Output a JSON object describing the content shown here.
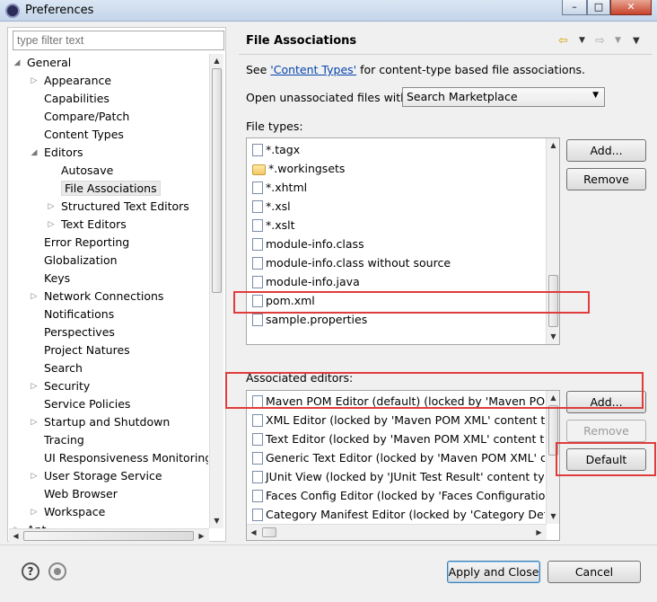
{
  "window": {
    "title": "Preferences",
    "min_label": "–",
    "max_label": "□",
    "close_label": "✕"
  },
  "filter": {
    "placeholder": "type filter text"
  },
  "tree": [
    {
      "label": "General",
      "indent": 0,
      "state": "open"
    },
    {
      "label": "Appearance",
      "indent": 1,
      "state": "closed"
    },
    {
      "label": "Capabilities",
      "indent": 1,
      "state": "leaf"
    },
    {
      "label": "Compare/Patch",
      "indent": 1,
      "state": "leaf"
    },
    {
      "label": "Content Types",
      "indent": 1,
      "state": "leaf"
    },
    {
      "label": "Editors",
      "indent": 1,
      "state": "open"
    },
    {
      "label": "Autosave",
      "indent": 2,
      "state": "leaf"
    },
    {
      "label": "File Associations",
      "indent": 2,
      "state": "leaf",
      "selected": true
    },
    {
      "label": "Structured Text Editors",
      "indent": 2,
      "state": "closed"
    },
    {
      "label": "Text Editors",
      "indent": 2,
      "state": "closed"
    },
    {
      "label": "Error Reporting",
      "indent": 1,
      "state": "leaf"
    },
    {
      "label": "Globalization",
      "indent": 1,
      "state": "leaf"
    },
    {
      "label": "Keys",
      "indent": 1,
      "state": "leaf"
    },
    {
      "label": "Network Connections",
      "indent": 1,
      "state": "closed"
    },
    {
      "label": "Notifications",
      "indent": 1,
      "state": "leaf"
    },
    {
      "label": "Perspectives",
      "indent": 1,
      "state": "leaf"
    },
    {
      "label": "Project Natures",
      "indent": 1,
      "state": "leaf"
    },
    {
      "label": "Search",
      "indent": 1,
      "state": "leaf"
    },
    {
      "label": "Security",
      "indent": 1,
      "state": "closed"
    },
    {
      "label": "Service Policies",
      "indent": 1,
      "state": "leaf"
    },
    {
      "label": "Startup and Shutdown",
      "indent": 1,
      "state": "closed"
    },
    {
      "label": "Tracing",
      "indent": 1,
      "state": "leaf"
    },
    {
      "label": "UI Responsiveness Monitoring",
      "indent": 1,
      "state": "leaf"
    },
    {
      "label": "User Storage Service",
      "indent": 1,
      "state": "closed"
    },
    {
      "label": "Web Browser",
      "indent": 1,
      "state": "leaf"
    },
    {
      "label": "Workspace",
      "indent": 1,
      "state": "closed"
    },
    {
      "label": "Ant",
      "indent": 0,
      "state": "closed"
    }
  ],
  "page": {
    "title": "File Associations",
    "see_prefix": "See ",
    "see_link": "'Content Types'",
    "see_suffix": " for content-type based file associations.",
    "open_label": "Open unassociated files with:",
    "open_value": "Search Marketplace",
    "file_types_label": "File types:",
    "assoc_label": "Associated editors:"
  },
  "file_types": [
    {
      "name": "*.tagx",
      "icon": "file-icon"
    },
    {
      "name": "*.workingsets",
      "icon": "folder-icon"
    },
    {
      "name": "*.xhtml",
      "icon": "web-file-icon"
    },
    {
      "name": "*.xsl",
      "icon": "xsl-file-icon"
    },
    {
      "name": "*.xslt",
      "icon": "xsl-file-icon"
    },
    {
      "name": "module-info.class",
      "icon": "class-file-icon"
    },
    {
      "name": "module-info.class without source",
      "icon": "class-file-icon"
    },
    {
      "name": "module-info.java",
      "icon": "java-file-icon"
    },
    {
      "name": "pom.xml",
      "icon": "maven-file-icon"
    },
    {
      "name": "sample.properties",
      "icon": "properties-file-icon"
    }
  ],
  "editors": [
    {
      "name": "Maven POM Editor (default) (locked by 'Maven POM",
      "icon": "maven-editor-icon"
    },
    {
      "name": "XML Editor (locked by 'Maven POM XML' content typ",
      "icon": "xml-editor-icon"
    },
    {
      "name": "Text Editor (locked by 'Maven POM XML' content typ",
      "icon": "text-editor-icon"
    },
    {
      "name": "Generic Text Editor (locked by 'Maven POM XML' co",
      "icon": "generic-editor-icon"
    },
    {
      "name": "JUnit View (locked by 'JUnit Test Result' content type)",
      "icon": "junit-icon"
    },
    {
      "name": "Faces Config Editor (locked by 'Faces Configuration F",
      "icon": "faces-icon"
    },
    {
      "name": "Category Manifest Editor (locked by 'Category Defini",
      "icon": "category-icon"
    }
  ],
  "buttons": {
    "add_types": "Add...",
    "remove_types": "Remove",
    "add_editor": "Add...",
    "remove_editor": "Remove",
    "default": "Default",
    "apply_close": "Apply and Close",
    "cancel": "Cancel"
  },
  "help": {
    "label": "?"
  }
}
